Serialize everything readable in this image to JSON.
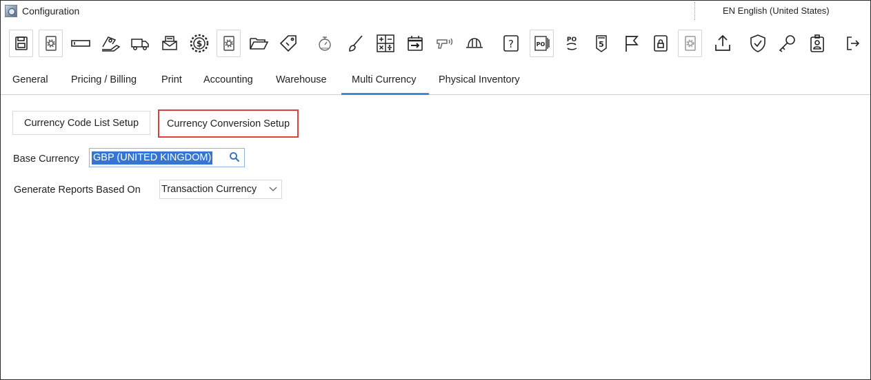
{
  "window": {
    "title": "Configuration",
    "language": "EN English (United States)"
  },
  "toolbar": {
    "buttons": [
      {
        "name": "save-icon"
      },
      {
        "name": "settings-doc-icon"
      },
      {
        "name": "barcode-label-icon"
      },
      {
        "name": "pricing-hand-icon"
      },
      {
        "name": "delivery-truck-icon"
      },
      {
        "name": "email-printer-icon"
      },
      {
        "name": "dollar-gear-icon"
      },
      {
        "name": "settings-doc-icon-2"
      },
      {
        "name": "folder-open-icon"
      },
      {
        "name": "tag-icon"
      },
      {
        "name": "timer-icon"
      },
      {
        "name": "brush-icon"
      },
      {
        "name": "calculator-icon"
      },
      {
        "name": "calendar-arrow-icon"
      },
      {
        "name": "barcode-scanner-icon"
      },
      {
        "name": "hard-hat-icon"
      },
      {
        "name": "help-icon"
      },
      {
        "name": "po-document-icon"
      },
      {
        "name": "po-sync-icon"
      },
      {
        "name": "dollar-receipt-icon"
      },
      {
        "name": "flag-icon"
      },
      {
        "name": "secure-document-icon"
      },
      {
        "name": "settings-doc-icon-3"
      },
      {
        "name": "upload-icon"
      },
      {
        "name": "shield-check-icon"
      },
      {
        "name": "key-icon"
      },
      {
        "name": "id-badge-icon"
      },
      {
        "name": "logout-icon"
      }
    ]
  },
  "tabs": [
    {
      "label": "General"
    },
    {
      "label": "Pricing / Billing"
    },
    {
      "label": "Print"
    },
    {
      "label": "Accounting"
    },
    {
      "label": "Warehouse"
    },
    {
      "label": "Multi Currency",
      "active": true
    },
    {
      "label": "Physical Inventory"
    }
  ],
  "multi_currency": {
    "code_list_button": "Currency Code List Setup",
    "conversion_button": "Currency Conversion Setup",
    "base_currency_label": "Base Currency",
    "base_currency_value": "GBP (UNITED KINGDOM)",
    "reports_label": "Generate Reports Based On",
    "reports_value": "Transaction Currency"
  },
  "colors": {
    "accent": "#3c8ad8",
    "highlight": "#d9403a",
    "selection": "#3476d2"
  }
}
